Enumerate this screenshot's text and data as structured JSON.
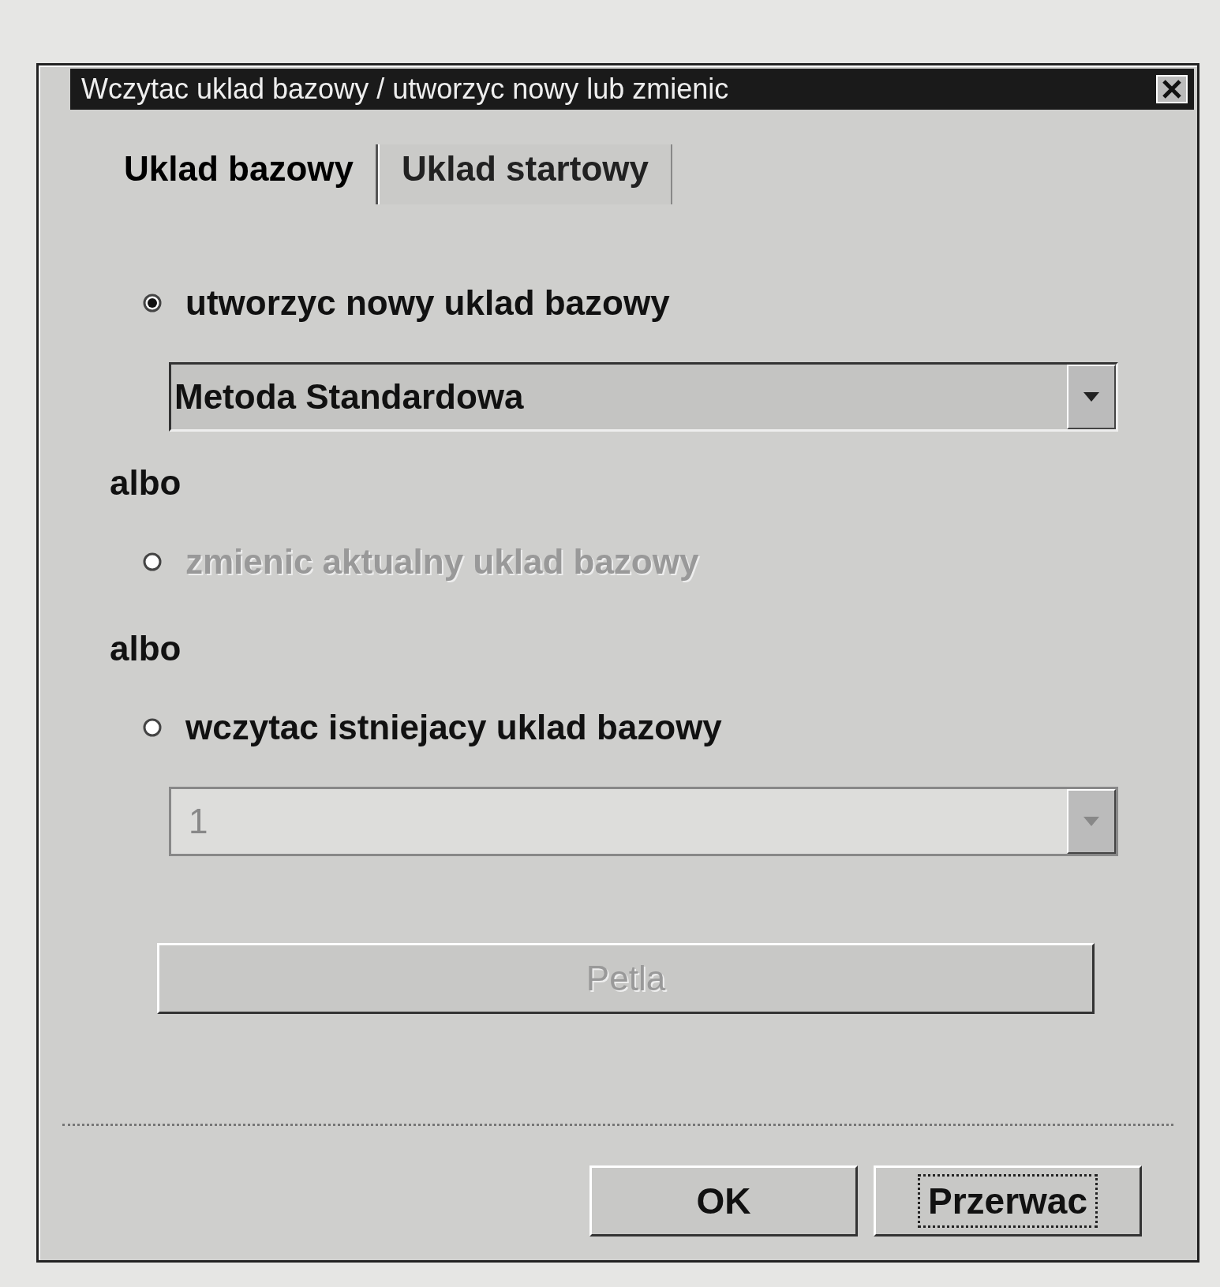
{
  "window": {
    "title": "Wczytac uklad bazowy / utworzyc nowy lub zmienic"
  },
  "tabs": [
    {
      "label": "Uklad bazowy",
      "selected": true
    },
    {
      "label": "Uklad startowy",
      "selected": false
    }
  ],
  "items": [
    {
      "kind": "radio",
      "label": "utworzyc nowy uklad bazowy",
      "selected": true,
      "disabled": false
    },
    {
      "kind": "dropdown",
      "value": "Metoda Standardowa",
      "disabled": false
    },
    {
      "kind": "text",
      "text": "albo"
    },
    {
      "kind": "radio",
      "label": "zmienic aktualny uklad bazowy",
      "selected": false,
      "disabled": true
    },
    {
      "kind": "text",
      "text": "albo"
    },
    {
      "kind": "radio",
      "label": "wczytac istniejacy uklad bazowy",
      "selected": false,
      "disabled": false
    },
    {
      "kind": "dropdown",
      "value": "1",
      "disabled": true
    },
    {
      "kind": "button",
      "label": "Petla",
      "disabled": true
    }
  ],
  "buttons": [
    {
      "label": "OK",
      "focused": false
    },
    {
      "label": "Przerwac",
      "focused": true
    }
  ]
}
